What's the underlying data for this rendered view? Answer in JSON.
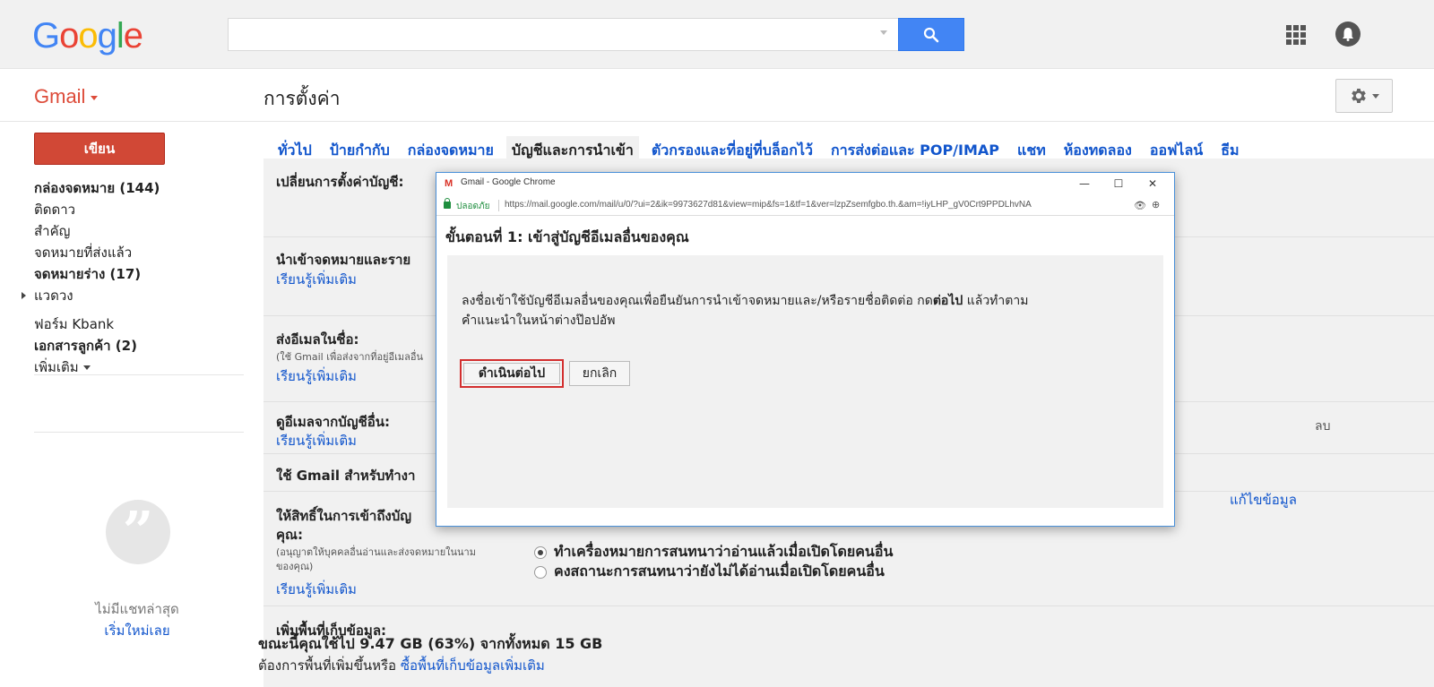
{
  "header": {
    "logo_letters": [
      "G",
      "o",
      "o",
      "g",
      "l",
      "e"
    ],
    "search_value": "",
    "search_button_icon": "search-icon",
    "apps_icon": "apps-grid-icon",
    "account_icon": "account-icon"
  },
  "subbar": {
    "gmail_label": "Gmail",
    "page_title": "การตั้งค่า",
    "settings_icon": "gear-icon"
  },
  "sidebar": {
    "compose_label": "เขียน",
    "folders": [
      {
        "label": "กล่องจดหมาย (144)",
        "bold": true
      },
      {
        "label": "ติดดาว",
        "bold": false
      },
      {
        "label": "สำคัญ",
        "bold": false
      },
      {
        "label": "จดหมายที่ส่งแล้ว",
        "bold": false
      },
      {
        "label": "จดหมายร่าง (17)",
        "bold": true
      },
      {
        "label": "แวดวง",
        "bold": false
      },
      {
        "label": "ฟอร์ม Kbank",
        "bold": false
      },
      {
        "label": "เอกสารลูกค้า (2)",
        "bold": true
      },
      {
        "label": "เพิ่มเติม",
        "bold": false
      }
    ],
    "no_chat_text": "ไม่มีแชทล่าสุด",
    "start_chat_link": "เริ่มใหม่เลย"
  },
  "tabs": [
    {
      "label": "ทั่วไป",
      "active": false
    },
    {
      "label": "ป้ายกำกับ",
      "active": false
    },
    {
      "label": "กล่องจดหมาย",
      "active": false
    },
    {
      "label": "บัญชีและการนำเข้า",
      "active": true
    },
    {
      "label": "ตัวกรองและที่อยู่ที่บล็อกไว้",
      "active": false
    },
    {
      "label": "การส่งต่อและ POP/IMAP",
      "active": false
    },
    {
      "label": "แชท",
      "active": false
    },
    {
      "label": "ห้องทดลอง",
      "active": false
    },
    {
      "label": "ออฟไลน์",
      "active": false
    },
    {
      "label": "ธีม",
      "active": false
    }
  ],
  "settings": {
    "row1_title": "เปลี่ยนการตั้งค่าบัญชี:",
    "row2_title": "นำเข้าจดหมายและราย",
    "row2_link": "เรียนรู้เพิ่มเติม",
    "row2_delete": "ลบ",
    "row3_title": "ส่งอีเมลในชื่อ:",
    "row3_note": "(ใช้ Gmail เพื่อส่งจากที่อยู่อีเมลอื่น",
    "row3_link": "เรียนรู้เพิ่มเติม",
    "row3_edit": "แก้ไขข้อมูล",
    "row4_title": "ดูอีเมลจากบัญชีอื่น:",
    "row4_link": "เรียนรู้เพิ่มเติม",
    "row5_title": "ใช้ Gmail สำหรับทำงา",
    "row6_title_line1": "ให้สิทธิ์ในการเข้าถึงบัญ",
    "row6_title_line2": "คุณ:",
    "row6_note_line1": "(อนุญาตให้บุคคลอื่นอ่านและส่งจดหมายในนาม",
    "row6_note_line2": "ของคุณ)",
    "row6_link": "เรียนรู้เพิ่มเติม",
    "row6_option1": "ทำเครื่องหมายการสนทนาว่าอ่านแล้วเมื่อเปิดโดยคนอื่น",
    "row6_option2": "คงสถานะการสนทนาว่ายังไม่ได้อ่านเมื่อเปิดโดยคนอื่น",
    "row7_title": "เพิ่มพื้นที่เก็บข้อมูล:",
    "storage_main": "ขณะนี้คุณใช้ไป 9.47 GB (63%) จากทั้งหมด 15 GB",
    "storage_sub_prefix": "ต้องการพื้นที่เพิ่มขึ้นหรือ",
    "storage_sub_link": "ซื้อพื้นที่เก็บข้อมูลเพิ่มเติม"
  },
  "popup": {
    "window_title": "Gmail - Google Chrome",
    "favicon_letter": "M",
    "secure_label": "ปลอดภัย",
    "url": "https://mail.google.com/mail/u/0/?ui=2&ik=9973627d81&view=mip&fs=1&tf=1&ver=lzpZsemfgbo.th.&am=!iyLHP_gV0Crt9PPDLhvNA",
    "heading": "ขั้นตอนที่ 1: เข้าสู่บัญชีอีเมลอื่นของคุณ",
    "desc_part1": "ลงชื่อเข้าใช้บัญชีอีเมลอื่นของคุณเพื่อยืนยันการนำเข้าจดหมายและ/หรือรายชื่อติดต่อ กด",
    "desc_bold": "ต่อไป",
    "desc_part2": " แล้วทำตาม",
    "desc_line2": "คำแนะนำในหน้าต่างป๊อปอัพ",
    "continue_label": "ดำเนินต่อไป",
    "cancel_label": "ยกเลิก",
    "minimize_glyph": "—",
    "maximize_glyph": "☐",
    "close_glyph": "✕"
  }
}
